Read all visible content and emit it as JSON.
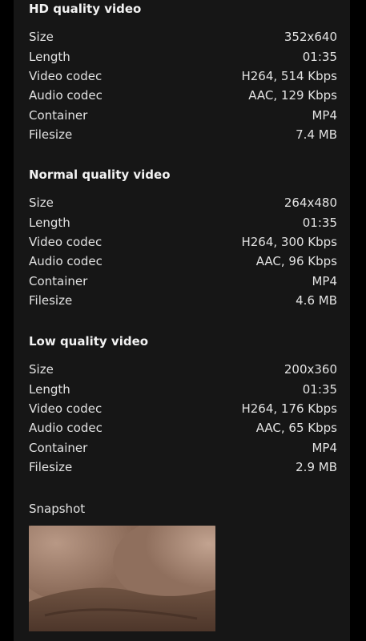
{
  "sections": [
    {
      "title": "HD quality video",
      "rows": [
        {
          "label": "Size",
          "value": "352x640"
        },
        {
          "label": "Length",
          "value": "01:35"
        },
        {
          "label": "Video codec",
          "value": "H264, 514 Kbps"
        },
        {
          "label": "Audio codec",
          "value": "AAC, 129 Kbps"
        },
        {
          "label": "Container",
          "value": "MP4"
        },
        {
          "label": "Filesize",
          "value": "7.4 MB"
        }
      ]
    },
    {
      "title": "Normal quality video",
      "rows": [
        {
          "label": "Size",
          "value": "264x480"
        },
        {
          "label": "Length",
          "value": "01:35"
        },
        {
          "label": "Video codec",
          "value": "H264, 300 Kbps"
        },
        {
          "label": "Audio codec",
          "value": "AAC, 96 Kbps"
        },
        {
          "label": "Container",
          "value": "MP4"
        },
        {
          "label": "Filesize",
          "value": "4.6 MB"
        }
      ]
    },
    {
      "title": "Low quality video",
      "rows": [
        {
          "label": "Size",
          "value": "200x360"
        },
        {
          "label": "Length",
          "value": "01:35"
        },
        {
          "label": "Video codec",
          "value": "H264, 176 Kbps"
        },
        {
          "label": "Audio codec",
          "value": "AAC, 65 Kbps"
        },
        {
          "label": "Container",
          "value": "MP4"
        },
        {
          "label": "Filesize",
          "value": "2.9 MB"
        }
      ]
    }
  ],
  "snapshot": {
    "label": "Snapshot"
  },
  "colors": {
    "page_background": "#000000",
    "panel_background": "#161616",
    "text": "#e2e2e2"
  }
}
